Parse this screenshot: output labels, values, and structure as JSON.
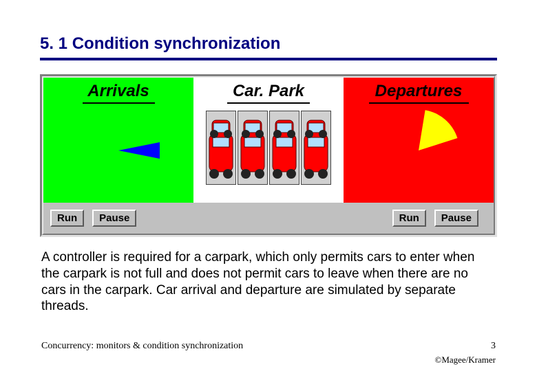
{
  "heading": "5. 1  Condition synchronization",
  "panels": {
    "arrivals": {
      "title": "Arrivals"
    },
    "carpark": {
      "title": "Car. Park",
      "slots": 4
    },
    "departures": {
      "title": "Departures"
    }
  },
  "buttons": {
    "run": "Run",
    "pause": "Pause"
  },
  "description": "A controller is required for a carpark, which only permits cars to enter when the carpark is not full and does not permit cars to leave when there are no cars in the carpark. Car arrival and departure are simulated by separate threads.",
  "footer": {
    "left": "Concurrency: monitors & condition synchronization",
    "right": "3"
  },
  "copyright": "©Magee/Kramer"
}
